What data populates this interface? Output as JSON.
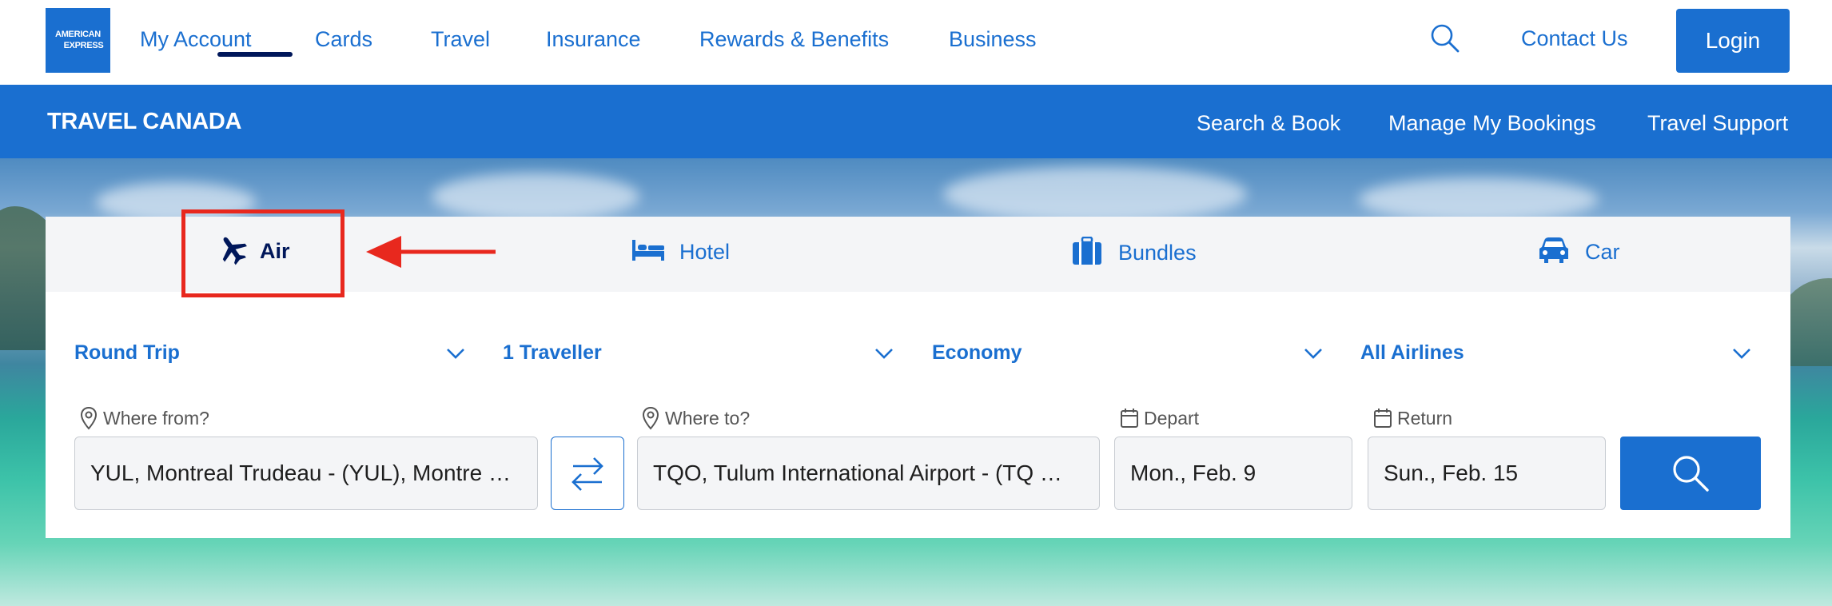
{
  "header": {
    "logo_text_1": "AMERICAN",
    "logo_text_2": "EXPRESS",
    "nav": [
      "My Account",
      "Cards",
      "Travel",
      "Insurance",
      "Rewards & Benefits",
      "Business"
    ],
    "search_icon": "search-icon",
    "contact_label": "Contact Us",
    "login_label": "Login"
  },
  "subnav": {
    "brand": "TRAVEL CANADA",
    "links": [
      "Search & Book",
      "Manage My Bookings",
      "Travel Support"
    ]
  },
  "tabs": [
    {
      "label": "Air",
      "icon": "plane-icon",
      "active": true
    },
    {
      "label": "Hotel",
      "icon": "bed-icon"
    },
    {
      "label": "Bundles",
      "icon": "suitcase-icon"
    },
    {
      "label": "Car",
      "icon": "car-icon"
    }
  ],
  "options": {
    "trip_type": "Round Trip",
    "travellers": "1 Traveller",
    "cabin": "Economy",
    "airlines": "All Airlines"
  },
  "fields": {
    "from_label": "Where from?",
    "from_value": "YUL, Montreal Trudeau - (YUL), Montre …",
    "to_label": "Where to?",
    "to_value": "TQO, Tulum International Airport - (TQ  …",
    "depart_label": "Depart",
    "depart_value": "Mon., Feb. 9",
    "return_label": "Return",
    "return_value": "Sun., Feb. 15"
  },
  "colors": {
    "brand_blue": "#1a6fd0",
    "navy": "#00175a",
    "annotation_red": "#e8281e"
  }
}
